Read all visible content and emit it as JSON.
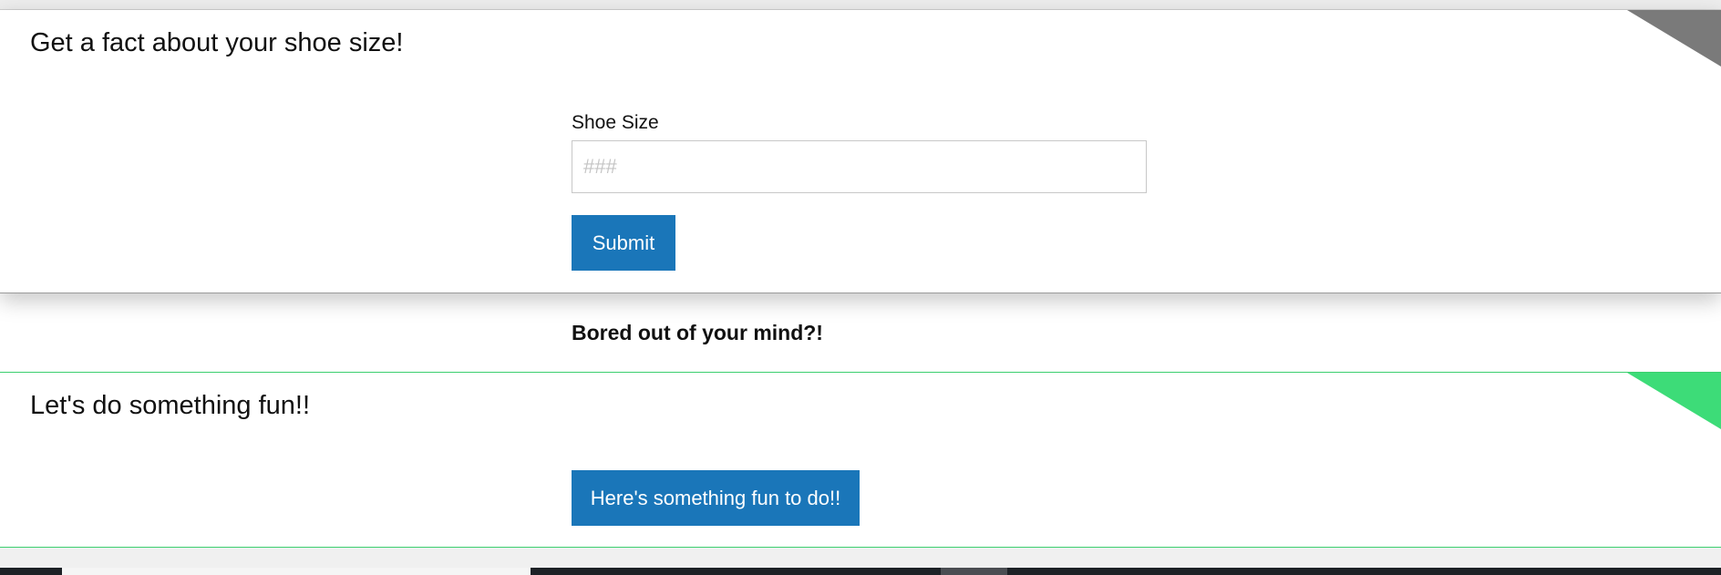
{
  "shoe_card": {
    "title": "Get a fact about your shoe size!",
    "field_label": "Shoe Size",
    "input_value": "",
    "input_placeholder": "###",
    "submit_label": "Submit",
    "corner_color": "#7a7a7a"
  },
  "bored": {
    "text": "Bored out of your mind?!"
  },
  "fun_card": {
    "title": "Let's do something fun!!",
    "button_label": "Here's something fun to do!!",
    "corner_color": "#3ddc78"
  },
  "theme": {
    "button_color": "#1a76b9",
    "fun_border_color": "#3ccf6e"
  }
}
